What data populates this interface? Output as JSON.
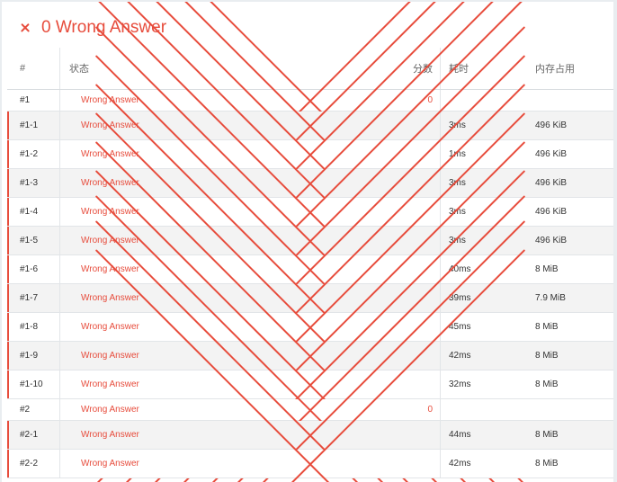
{
  "header": {
    "title": "0 Wrong Answer",
    "accent_color": "#e74c3c",
    "icon": "close-icon"
  },
  "columns": {
    "id": "#",
    "status": "状态",
    "score": "分数",
    "time": "耗时",
    "memory": "内存占用"
  },
  "rows": [
    {
      "type": "task",
      "id": "#1",
      "status": "Wrong Answer",
      "score": "0",
      "time": "",
      "memory": ""
    },
    {
      "type": "sub",
      "id": "#1-1",
      "status": "Wrong Answer",
      "score": "",
      "time": "3ms",
      "memory": "496 KiB"
    },
    {
      "type": "sub",
      "id": "#1-2",
      "status": "Wrong Answer",
      "score": "",
      "time": "1ms",
      "memory": "496 KiB"
    },
    {
      "type": "sub",
      "id": "#1-3",
      "status": "Wrong Answer",
      "score": "",
      "time": "3ms",
      "memory": "496 KiB"
    },
    {
      "type": "sub",
      "id": "#1-4",
      "status": "Wrong Answer",
      "score": "",
      "time": "3ms",
      "memory": "496 KiB"
    },
    {
      "type": "sub",
      "id": "#1-5",
      "status": "Wrong Answer",
      "score": "",
      "time": "3ms",
      "memory": "496 KiB"
    },
    {
      "type": "sub",
      "id": "#1-6",
      "status": "Wrong Answer",
      "score": "",
      "time": "40ms",
      "memory": "8 MiB"
    },
    {
      "type": "sub",
      "id": "#1-7",
      "status": "Wrong Answer",
      "score": "",
      "time": "39ms",
      "memory": "7.9 MiB"
    },
    {
      "type": "sub",
      "id": "#1-8",
      "status": "Wrong Answer",
      "score": "",
      "time": "45ms",
      "memory": "8 MiB"
    },
    {
      "type": "sub",
      "id": "#1-9",
      "status": "Wrong Answer",
      "score": "",
      "time": "42ms",
      "memory": "8 MiB"
    },
    {
      "type": "sub",
      "id": "#1-10",
      "status": "Wrong Answer",
      "score": "",
      "time": "32ms",
      "memory": "8 MiB"
    },
    {
      "type": "task",
      "id": "#2",
      "status": "Wrong Answer",
      "score": "0",
      "time": "",
      "memory": ""
    },
    {
      "type": "sub",
      "id": "#2-1",
      "status": "Wrong Answer",
      "score": "",
      "time": "44ms",
      "memory": "8 MiB"
    },
    {
      "type": "sub",
      "id": "#2-2",
      "status": "Wrong Answer",
      "score": "",
      "time": "42ms",
      "memory": "8 MiB"
    }
  ]
}
